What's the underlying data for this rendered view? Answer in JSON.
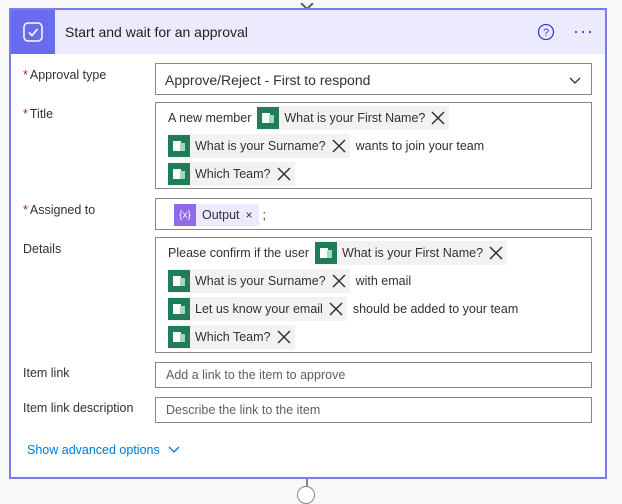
{
  "header": {
    "title": "Start and wait for an approval",
    "more_label": "···"
  },
  "fields": {
    "approval_type": {
      "label": "Approval type",
      "required": "*",
      "value": "Approve/Reject - First to respond"
    },
    "title": {
      "label": "Title",
      "required": "*",
      "lines": [
        [
          "A new member",
          "What is your First Name?"
        ],
        [
          "What is your Surname?",
          "wants to join your team"
        ],
        [
          "Which Team?"
        ]
      ]
    },
    "assigned_to": {
      "label": "Assigned to",
      "required": "*",
      "token": "Output",
      "token_icon": "{x}",
      "separator": ";"
    },
    "details": {
      "label": "Details",
      "lines": [
        [
          "Please confirm if the user",
          "What is your First Name?"
        ],
        [
          "What is your Surname?",
          "with email"
        ],
        [
          "Let us know your email",
          "should be added to your team"
        ],
        [
          "Which Team?"
        ]
      ]
    },
    "item_link": {
      "label": "Item link",
      "placeholder": "Add a link to the item to approve"
    },
    "item_link_description": {
      "label": "Item link description",
      "placeholder": "Describe the link to the item"
    }
  },
  "advanced": {
    "label": "Show advanced options"
  },
  "colors": {
    "accent": "#6a6cf0",
    "border": "#7a7cf0",
    "link": "#0078d4",
    "forms": "#1f7d58"
  }
}
